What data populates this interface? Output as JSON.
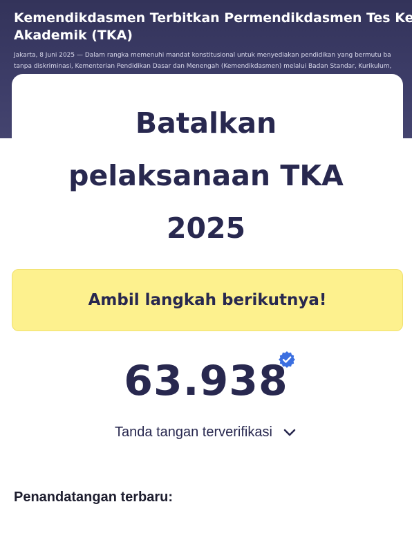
{
  "news": {
    "headline_line1": "Kemendikdasmen Terbitkan Permendikdasmen Tes Kem",
    "headline_line2": "Akademik (TKA)",
    "excerpt_line1": "Jakarta, 8 Juni 2025 — Dalam rangka memenuhi mandat konstitusional untuk menyediakan pendidikan yang bermutu ba",
    "excerpt_line2": "tanpa diskriminasi, Kementerian Pendidikan Dasar dan Menengah (Kemendikdasmen) melalui Badan Standar, Kurikulum,"
  },
  "petition": {
    "title_line1": "Batalkan",
    "title_line2": "pelaksanaan TKA",
    "title_line3": "2025",
    "cta_label": "Ambil langkah berikutnya!",
    "signature_count": "63.938",
    "verified_label": "Tanda tangan terverifikasi",
    "recent_signers_heading": "Penandatangan terbaru:"
  },
  "colors": {
    "header_bg": "#3a3a63",
    "title_text": "#28284f",
    "cta_bg": "#fdf18e",
    "verified_badge": "#3b6fe0"
  },
  "icons": {
    "verified": "verified-badge-icon",
    "expand": "chevron-down-icon"
  }
}
